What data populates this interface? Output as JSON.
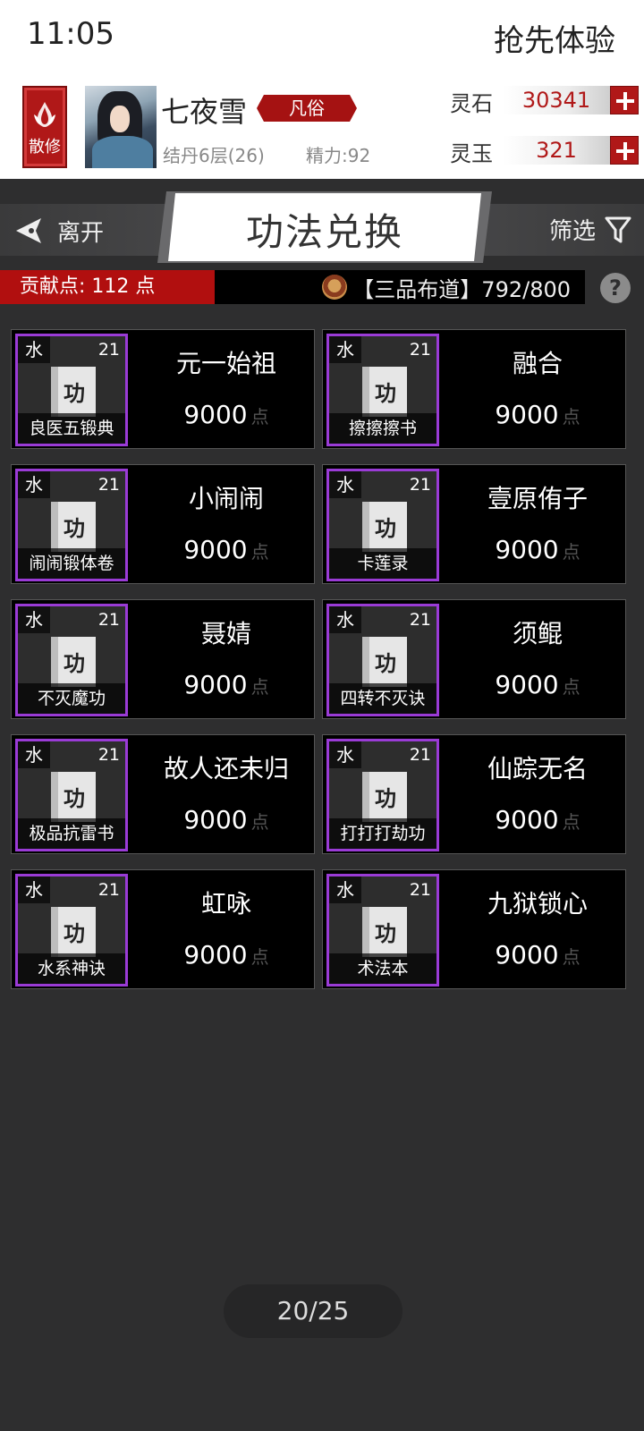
{
  "status": {
    "time": "11:05",
    "early_access": "抢先体验"
  },
  "player": {
    "sect": "散修",
    "name": "七夜雪",
    "rank": "凡俗",
    "realm": "结丹6层(26)",
    "energy": "精力:92"
  },
  "currency": [
    {
      "label": "灵石",
      "value": "30341"
    },
    {
      "label": "灵玉",
      "value": "321"
    }
  ],
  "header": {
    "leave": "离开",
    "title": "功法兑换",
    "filter": "筛选"
  },
  "contribution": {
    "points": "贡献点: 112 点",
    "rank_progress": "【三品布道】792/800",
    "help": "?"
  },
  "cards": [
    {
      "element": "水",
      "level": "21",
      "glyph": "功",
      "book": "良医五锻典",
      "seller": "元一始祖",
      "price": "9000",
      "unit": "点"
    },
    {
      "element": "水",
      "level": "21",
      "glyph": "功",
      "book": "擦擦擦书",
      "seller": "融合",
      "price": "9000",
      "unit": "点"
    },
    {
      "element": "水",
      "level": "21",
      "glyph": "功",
      "book": "闹闹锻体卷",
      "seller": "小闹闹",
      "price": "9000",
      "unit": "点"
    },
    {
      "element": "水",
      "level": "21",
      "glyph": "功",
      "book": "卡莲录",
      "seller": "壹原侑子",
      "price": "9000",
      "unit": "点"
    },
    {
      "element": "水",
      "level": "21",
      "glyph": "功",
      "book": "不灭魔功",
      "seller": "聂婧",
      "price": "9000",
      "unit": "点"
    },
    {
      "element": "水",
      "level": "21",
      "glyph": "功",
      "book": "四转不灭诀",
      "seller": "须鲲",
      "price": "9000",
      "unit": "点"
    },
    {
      "element": "水",
      "level": "21",
      "glyph": "功",
      "book": "极品抗雷书",
      "seller": "故人还未归",
      "price": "9000",
      "unit": "点"
    },
    {
      "element": "水",
      "level": "21",
      "glyph": "功",
      "book": "打打打劫功",
      "seller": "仙踪无名",
      "price": "9000",
      "unit": "点"
    },
    {
      "element": "水",
      "level": "21",
      "glyph": "功",
      "book": "水系神诀",
      "seller": "虹咏",
      "price": "9000",
      "unit": "点"
    },
    {
      "element": "水",
      "level": "21",
      "glyph": "功",
      "book": "术法本",
      "seller": "九狱锁心",
      "price": "9000",
      "unit": "点"
    }
  ],
  "pager": "20/25",
  "colors": {
    "accent_red": "#b01818",
    "frame_purple": "#9a3bd6"
  }
}
